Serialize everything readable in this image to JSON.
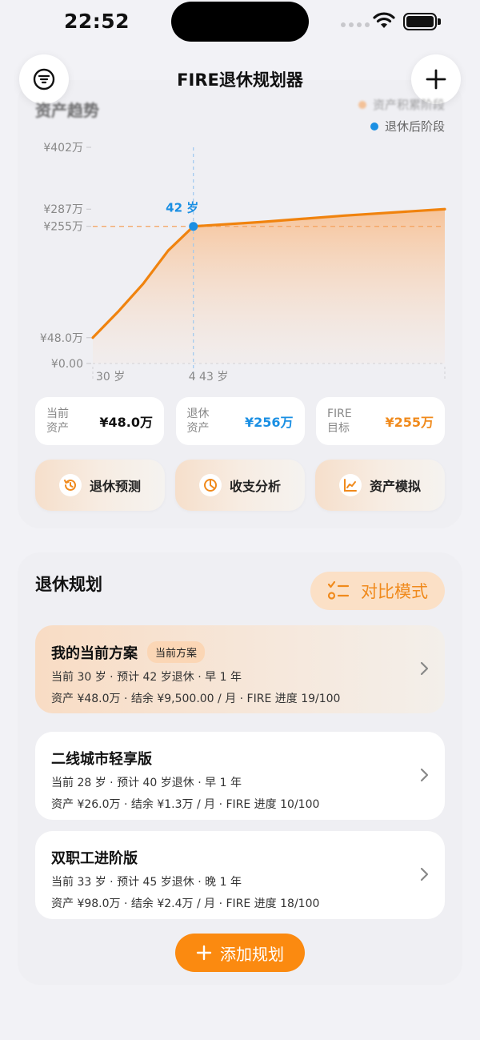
{
  "status": {
    "time": "22:52"
  },
  "nav": {
    "title": "FIRE退休规划器"
  },
  "trend": {
    "title": "资产趋势",
    "legend": [
      {
        "label": "资产积累阶段",
        "color": "#f6a35c"
      },
      {
        "label": "退休后阶段",
        "color": "#1a8fe3"
      }
    ]
  },
  "chart_data": {
    "type": "area",
    "title": "资产趋势",
    "y_tick_labels": [
      "¥402万",
      "¥287万",
      "¥255万",
      "¥48.0万",
      "¥0.00"
    ],
    "y_ticks": [
      402,
      287,
      255,
      48,
      0
    ],
    "ylim": [
      0,
      402
    ],
    "x_tick_labels": [
      "30 岁",
      "4 43 岁"
    ],
    "xlim": [
      30,
      72
    ],
    "series": [
      {
        "name": "资产积累阶段",
        "color": "#f0830e",
        "points": [
          [
            30,
            48
          ],
          [
            33,
            96
          ],
          [
            36,
            148
          ],
          [
            39,
            210
          ],
          [
            42,
            255
          ]
        ]
      },
      {
        "name": "退休后阶段",
        "color": "#f0830e",
        "points": [
          [
            42,
            255
          ],
          [
            50,
            263
          ],
          [
            60,
            275
          ],
          [
            72,
            287
          ]
        ]
      }
    ],
    "annotation": {
      "label": "42 岁",
      "x": 42,
      "y": 255,
      "color": "#1a8fe3"
    },
    "reference_line_y": 255
  },
  "stats": [
    {
      "label": "当前资产",
      "value": "¥48.0万",
      "color": "#111111"
    },
    {
      "label": "退休资产",
      "value": "¥256万",
      "color": "#1a8fe3"
    },
    {
      "label": "FIRE目标",
      "value": "¥255万",
      "color": "#f08a1c"
    }
  ],
  "actions": [
    {
      "label": "退休预测",
      "icon": "history-icon"
    },
    {
      "label": "收支分析",
      "icon": "pie-chart-icon"
    },
    {
      "label": "资产模拟",
      "icon": "trend-chart-icon"
    }
  ],
  "planning": {
    "title": "退休规划",
    "compare_label": "对比模式",
    "add_label": "添加规划",
    "plans": [
      {
        "name": "我的当前方案",
        "badge": "当前方案",
        "line1": "当前 30 岁 · 预计 42 岁退休 · 早 1 年",
        "line2": "资产 ¥48.0万 · 结余 ¥9,500.00 / 月 · FIRE 进度 19/100"
      },
      {
        "name": "二线城市轻享版",
        "line1": "当前 28 岁 · 预计 40 岁退休 · 早 1 年",
        "line2": "资产 ¥26.0万 · 结余 ¥1.3万 / 月 · FIRE 进度 10/100"
      },
      {
        "name": "双职工进阶版",
        "line1": "当前 33 岁 · 预计 45 岁退休 · 晚 1 年",
        "line2": "资产 ¥98.0万 · 结余 ¥2.4万 / 月 · FIRE 进度 18/100"
      }
    ]
  }
}
